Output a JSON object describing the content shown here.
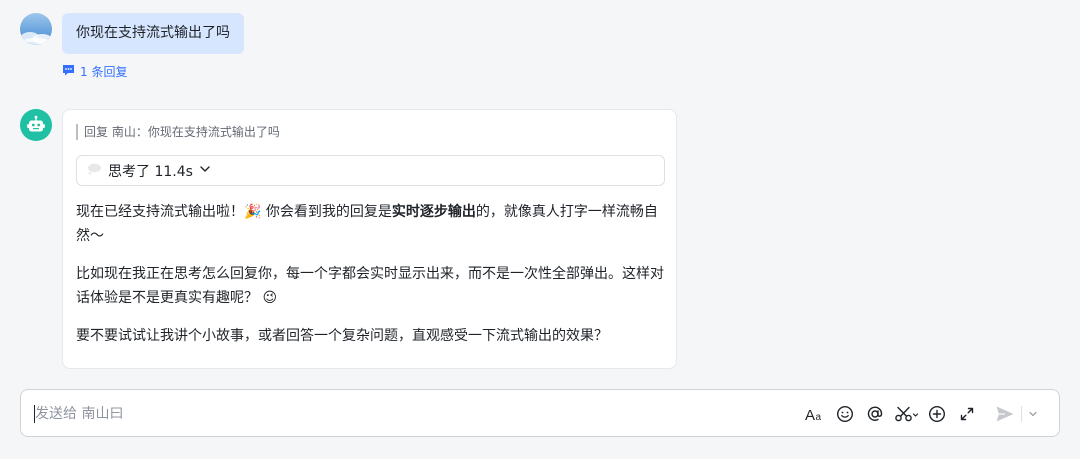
{
  "user_message": {
    "text": "你现在支持流式输出了吗",
    "reply_count": "1 条回复"
  },
  "bot_message": {
    "quote": "回复 南山：你现在支持流式输出了吗",
    "thinking_label": "思考了 11.4s",
    "p1_before": "现在已经支持流式输出啦！",
    "p1_emoji": "🎉",
    "p1_mid": " 你会看到我的回复是",
    "p1_bold": "实时逐步输出",
    "p1_after": "的，就像真人打字一样流畅自然～",
    "p2_text": "比如现在我正在思考怎么回复你，每一个字都会实时显示出来，而不是一次性全部弹出。这样对话体验是不是更真实有趣呢？",
    "p2_emoji": "😉",
    "p3": "要不要试试让我讲个小故事，或者回答一个复杂问题，直观感受一下流式输出的效果？"
  },
  "composer": {
    "placeholder": "发送给 南山曰"
  },
  "icons": {
    "user_avatar": "sky-avatar",
    "bot_avatar": "robot-icon",
    "reply": "comment-icon",
    "thinking": "thought-bubble-icon",
    "chevron": "chevron-down-icon",
    "format": "text-format-icon",
    "emoji": "emoji-icon",
    "mention": "at-mention-icon",
    "screenshot": "scissors-icon",
    "add": "plus-circle-icon",
    "expand": "expand-icon",
    "send": "send-icon"
  },
  "colors": {
    "accent": "#3370ff",
    "user_bubble": "#d7e6ff",
    "bot_avatar": "#1fc0a3"
  }
}
